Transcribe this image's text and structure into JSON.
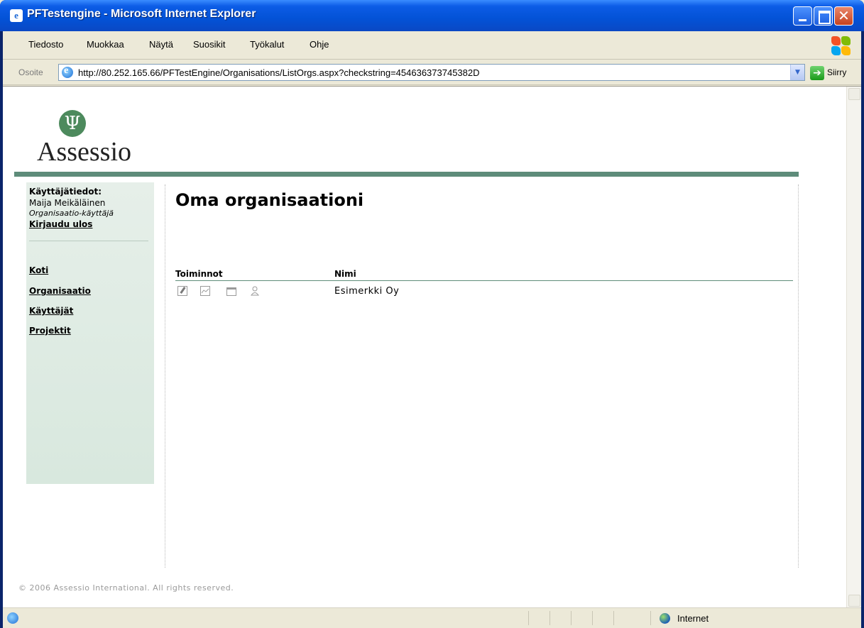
{
  "window": {
    "title": "PFTestengine - Microsoft Internet Explorer",
    "close_glyph": "✕"
  },
  "menu": {
    "items": [
      "Tiedosto",
      "Muokkaa",
      "Näytä",
      "Suosikit",
      "Työkalut",
      "Ohje"
    ]
  },
  "address": {
    "label": "Osoite",
    "url": "http://80.252.165.66/PFTestEngine/Organisations/ListOrgs.aspx?checkstring=454636373745382D",
    "go_label": "Siirry"
  },
  "logo": {
    "symbol": "Ψ",
    "text": "Assessio"
  },
  "sidebar": {
    "user_label": "Käyttäjätiedot:",
    "user_name": "Maija Meikäläinen",
    "user_role": "Organisaatio-käyttäjä",
    "logout": "Kirjaudu ulos",
    "nav": [
      "Koti",
      "Organisaatio",
      "Käyttäjät",
      "Projektit"
    ]
  },
  "main": {
    "title": "Oma organisaationi",
    "columns": [
      "Toiminnot",
      "Nimi"
    ],
    "rows": [
      {
        "name": "Esimerkki Oy",
        "icons": [
          "edit-icon",
          "chart-icon",
          "folder-icon",
          "user-icon"
        ]
      }
    ]
  },
  "footer": {
    "copyright": "© 2006 Assessio International. All rights reserved."
  },
  "status": {
    "zone": "Internet"
  },
  "colors": {
    "titlebar": "#0352d6",
    "brand_green": "#5e8c7a",
    "sidebar_bg": "#e6efe9"
  }
}
